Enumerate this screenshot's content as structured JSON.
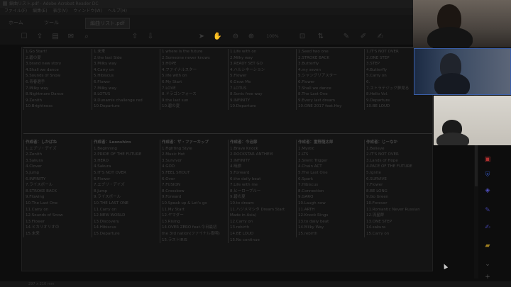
{
  "window": {
    "title": "編曲リスト.pdf - Adobe Acrobat Reader DC"
  },
  "menu": [
    "ファイル(F)",
    "編集(E)",
    "表示(V)",
    "ウィンドウ(W)",
    "ヘルプ(H)"
  ],
  "tabs": {
    "home": "ホーム",
    "tools": "ツール",
    "document": "編曲リスト.pdf"
  },
  "toolbar": {
    "zoom": "100%"
  },
  "top_columns": [
    [
      "1.Go Start!",
      "2.碧の夏",
      "3.brand new story",
      "4.Shall we dance",
      "5.Sounds of Snow",
      "6.青春選手",
      "7.Milky way",
      "8.Nightmare Dance",
      "9.Zenith",
      "10.Brightness"
    ],
    [
      "1.未来",
      "2.the last Side",
      "3.Milky way",
      "4.Carry on",
      "5.Hibiscus",
      "6.Flower",
      "7.Milky way",
      "8.LOTUS",
      "9.Dunamis challenge red",
      "10.Departure"
    ],
    [
      "1.where is the future",
      "2.Someone never knows",
      "3.HOPE",
      "4.ファイナルスター",
      "5.life with on",
      "6.My Start",
      "7.LOVE",
      "8.ドラゴンフォース",
      "9.the last sun",
      "10.碧の夏"
    ],
    [
      "1.Life with on",
      "2.Milky way",
      "3.READY SET GO",
      "4.ハルシネーション",
      "5.Flower",
      "6.Grow Me",
      "7.LOTUS",
      "8.Sonic free way",
      "9.INFINITY",
      "10.Departure"
    ],
    [
      "1.Seed two one",
      "2.STROKE BACK",
      "3.Butterfly",
      "4.my seven",
      "5.シャングリアスター",
      "6.Flower",
      "7.Shall we dance",
      "8.The Last One",
      "9.Every last dream",
      "10.ONE 2017 feat.Hey"
    ],
    [
      "1.IT'S NOT OVER",
      "2.ONE STEP",
      "3.STEP",
      "4.Butterfly",
      "5.Carry on",
      "6.",
      "7.ストラテジック夢見る",
      "8.Hello Vol.",
      "9.Departure",
      "10.BE LOUD"
    ]
  ],
  "bottom_columns": [
    {
      "head": "作成者：しかばね",
      "items": [
        "1.エブリ・デイズ",
        "2.Zenith",
        "3.Sakura",
        "4.Clover",
        "5.Jump",
        "6.INFINITY",
        "7.ライスボール",
        "8.STROKE BACK",
        "9.Flowing",
        "10.The Last One",
        "11.Carry on",
        "12.Sounds of Snow",
        "13.Flower",
        "14.ヒカリオリオの",
        "15.未来"
      ]
    },
    {
      "head": "作成者：Leonshiro",
      "items": [
        "1.Beginning",
        "2.PRIDE OF THE FUTURE",
        "3.HERO",
        "4.Sakura",
        "5.IT'S NOT OVER",
        "6.Flower",
        "7.エブリ・デイズ",
        "8.Jump",
        "9.ライスボール",
        "10.THE LAST ONE",
        "11.Carry on",
        "12.NEW WORLD",
        "13.Discovery",
        "14.Hibiscus",
        "15.Departure"
      ]
    },
    {
      "head": "作成者：ザ・ファーカップ",
      "items": [
        "1.Fighting Style",
        "2.Music Hot",
        "3.Survivor",
        "4.GOD",
        "5.FEEL SHOUT",
        "6.Over",
        "7.FUSION",
        "8.Crossbow",
        "9.Forward",
        "10.Speak up & Let's go",
        "11.My Start",
        "12.ヤマダー",
        "13.Rising",
        "14.OVER ZERO feat.今日最初",
        "the 3rd nation(ファイナル夜明)",
        "15.ラストIRIS"
      ]
    },
    {
      "head": "作成者：今治節",
      "items": [
        "1.Brave Knock",
        "2.ROCKSTAR ANTHEM",
        "3.INFINITY",
        "4.暁旅",
        "5.Forward",
        "6.the daily beat",
        "7.Life with me",
        "8.ヒーローブルー",
        "9.碧の夏",
        "10.to dream",
        "11.ハジメマシタ Dream Start",
        "Made in Asia)",
        "12.Carry on",
        "13.rebirth",
        "14.BE LOUD",
        "15.No continue"
      ]
    },
    {
      "head": "作成者：重野龍太郎",
      "items": [
        "1.Mystic",
        "2.LTS",
        "3.Silent Trigger",
        "4.Chain ACT",
        "5.The Last One",
        "6.Spark",
        "7.Hibiscus",
        "8.Connection",
        "9.GARO",
        "10.Laugh now",
        "11.ARTH",
        "12.Knock Rings",
        "13.to daily beat",
        "14.Milky Way",
        "15.rebirth"
      ]
    },
    {
      "head": "作成者：じーなか",
      "items": [
        "1.Believe",
        "2.IT'S NOT OVER",
        "3.Lands of Hope",
        "4.PACE OF THE FUTURE",
        "5.Ignite",
        "6.SURVIVE",
        "7.Flower",
        "8.BE LONG",
        "9.Go Green",
        "10.Forever",
        "11.Romantic Never Russian",
        "12.流星群",
        "13.ONE STEP",
        "14.sakura",
        "15.Carry on"
      ]
    }
  ],
  "status": {
    "page_size": "297 x 210 mm"
  },
  "icons": [
    "save-icon",
    "upload-icon",
    "print-icon",
    "mail-icon",
    "search-icon",
    "cursor-icon",
    "hand-icon",
    "zoom-out-icon",
    "zoom-in-icon",
    "comment-icon",
    "pen-icon",
    "sign-icon"
  ]
}
